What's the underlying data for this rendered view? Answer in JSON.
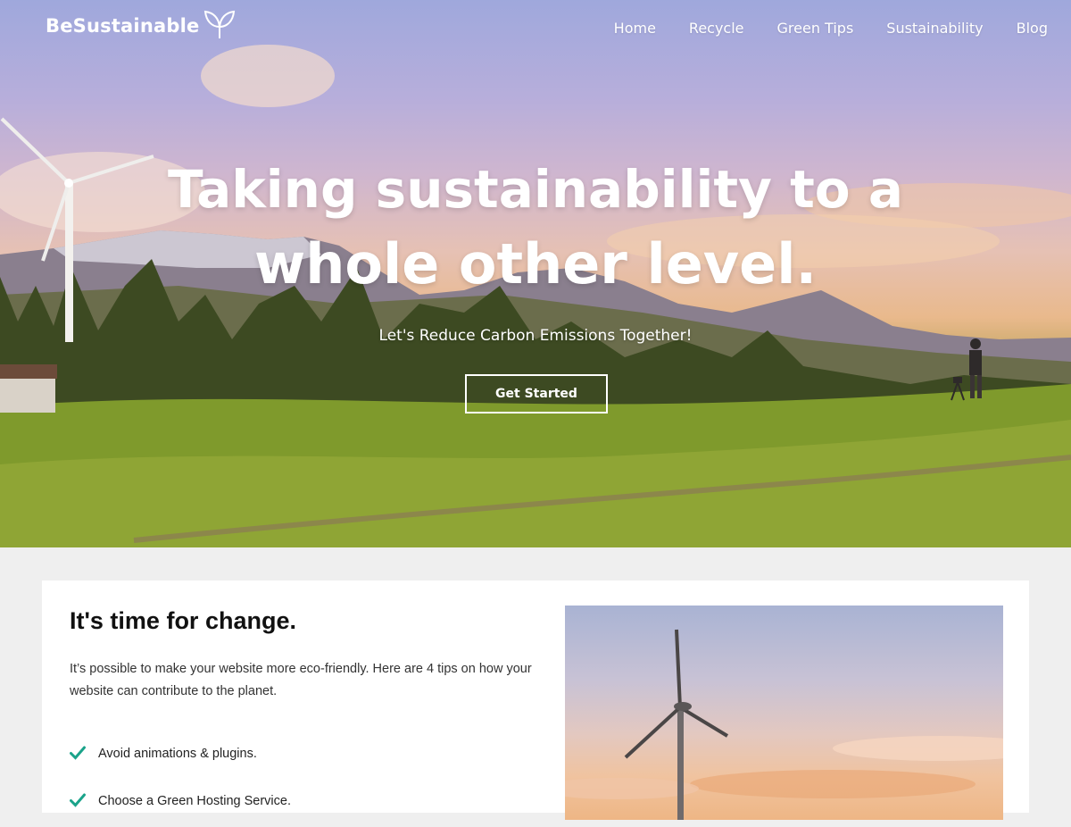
{
  "brand": {
    "name": "BeSustainable",
    "icon": "leaf-sprout-icon"
  },
  "nav": {
    "items": [
      {
        "label": "Home"
      },
      {
        "label": "Recycle"
      },
      {
        "label": "Green Tips"
      },
      {
        "label": "Sustainability"
      },
      {
        "label": "Blog"
      }
    ]
  },
  "hero": {
    "title_line1": "Taking sustainability to a",
    "title_line2": "whole other level.",
    "subtitle": "Let's Reduce Carbon Emissions Together!",
    "cta_label": "Get Started"
  },
  "section": {
    "title": "It's time for change.",
    "description": "It’s possible to make your website more eco-friendly. Here are 4 tips on how your website can contribute to the planet.",
    "tips": [
      {
        "label": "Avoid animations & plugins.",
        "icon": "checkmark-icon"
      },
      {
        "label": "Choose a Green Hosting Service.",
        "icon": "checkmark-icon"
      }
    ]
  },
  "colors": {
    "check_accent": "#1aa38a",
    "page_background": "#efefef",
    "card_background": "#ffffff"
  }
}
